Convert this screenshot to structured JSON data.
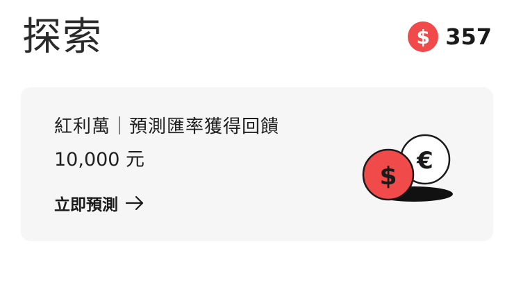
{
  "header": {
    "title": "探索",
    "balance": {
      "icon": "dollar-coin-icon",
      "amount": "357",
      "currency_symbol": "$"
    }
  },
  "promo_card": {
    "title": "紅利萬｜預測匯率獲得回饋",
    "amount": "10,000 元",
    "cta_label": "立即預測",
    "cta_icon": "arrow-right-icon",
    "illustration": {
      "front_coin_symbol": "$",
      "back_coin_symbol": "€",
      "front_coin_color": "#f04a4a",
      "back_coin_color": "#ffffff",
      "shadow_color": "#111111"
    }
  },
  "colors": {
    "accent": "#f04a4a",
    "card_background": "#f6f6f6"
  }
}
